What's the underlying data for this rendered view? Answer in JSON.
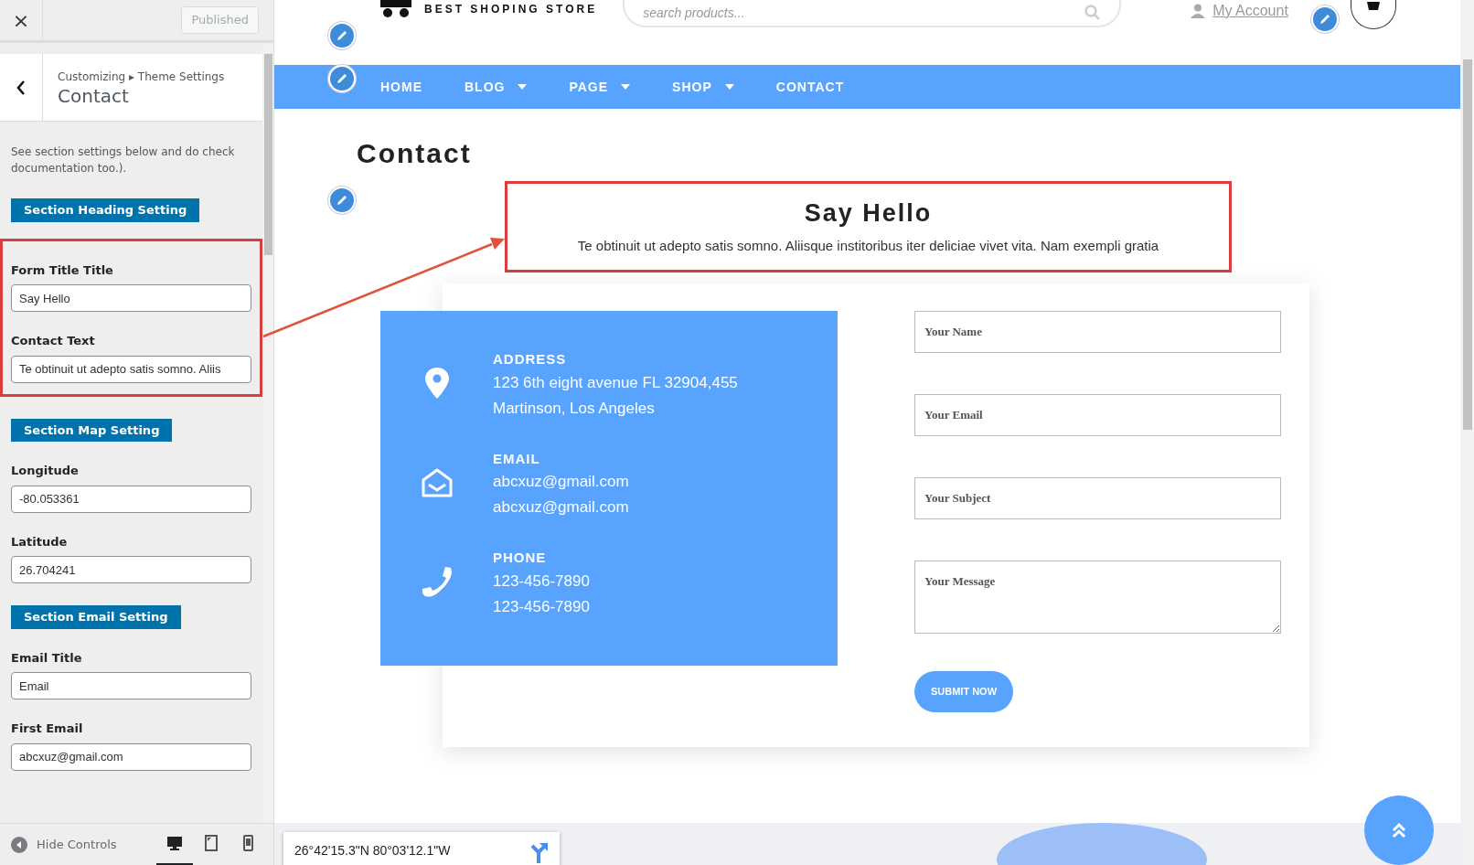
{
  "sidebar": {
    "close_label": "×",
    "publish_button": {
      "label": "Published",
      "disabled": true
    },
    "breadcrumb": "Customizing ▸ Theme Settings",
    "title": "Contact",
    "description": "See section settings below and do check documentation too.).",
    "sections": [
      {
        "kind": "heading",
        "label": "Section Heading Setting"
      },
      {
        "kind": "group",
        "highlighted": true,
        "fields": [
          {
            "label": "Form Title Title",
            "value": "Say Hello"
          },
          {
            "label": "Contact Text",
            "value": "Te obtinuit ut adepto satis somno. Aliis"
          }
        ]
      },
      {
        "kind": "heading",
        "label": "Section Map Setting"
      },
      {
        "kind": "field",
        "label": "Longitude",
        "value": "-80.053361"
      },
      {
        "kind": "field",
        "label": "Latitude",
        "value": "26.704241"
      },
      {
        "kind": "heading",
        "label": "Section Email Setting"
      },
      {
        "kind": "field",
        "label": "Email Title",
        "value": "Email"
      },
      {
        "kind": "field",
        "label": "First Email",
        "value": "abcxuz@gmail.com"
      }
    ],
    "footer": {
      "hide_controls": "Hide Controls",
      "devices": [
        {
          "kind": "desktop",
          "selected": true
        },
        {
          "kind": "tablet",
          "selected": false
        },
        {
          "kind": "mobile",
          "selected": false
        }
      ]
    }
  },
  "preview": {
    "header": {
      "logo_text": "BEST SHOPING STORE",
      "search_placeholder": "search products...",
      "account": "My Account"
    },
    "nav": [
      {
        "label": "HOME",
        "dropdown": false
      },
      {
        "label": "BLOG",
        "dropdown": true
      },
      {
        "label": "PAGE",
        "dropdown": true
      },
      {
        "label": "SHOP",
        "dropdown": true
      },
      {
        "label": "CONTACT",
        "dropdown": false
      }
    ],
    "page_title": "Contact",
    "heading_block": {
      "title": "Say Hello",
      "text": "Te obtinuit ut adepto satis somno. Aliisque institoribus iter deliciae vivet vita. Nam exempli gratia",
      "highlighted": true
    },
    "contact_info": [
      {
        "kind": "address",
        "label": "ADDRESS",
        "lines": [
          "123 6th eight avenue FL 32904,455",
          "Martinson, Los Angeles"
        ]
      },
      {
        "kind": "email",
        "label": "EMAIL",
        "lines": [
          "abcxuz@gmail.com",
          "abcxuz@gmail.com"
        ]
      },
      {
        "kind": "phone",
        "label": "PHONE",
        "lines": [
          "123-456-7890",
          "123-456-7890"
        ]
      }
    ],
    "form": {
      "fields": [
        {
          "kind": "input",
          "placeholder": "Your Name"
        },
        {
          "kind": "input",
          "placeholder": "Your Email"
        },
        {
          "kind": "input",
          "placeholder": "Your Subject"
        },
        {
          "kind": "textarea",
          "placeholder": "Your Message"
        }
      ],
      "submit": "SUBMIT NOW"
    },
    "map": {
      "coordinates": "26°42'15.3\"N 80°03'12.1\"W"
    }
  }
}
